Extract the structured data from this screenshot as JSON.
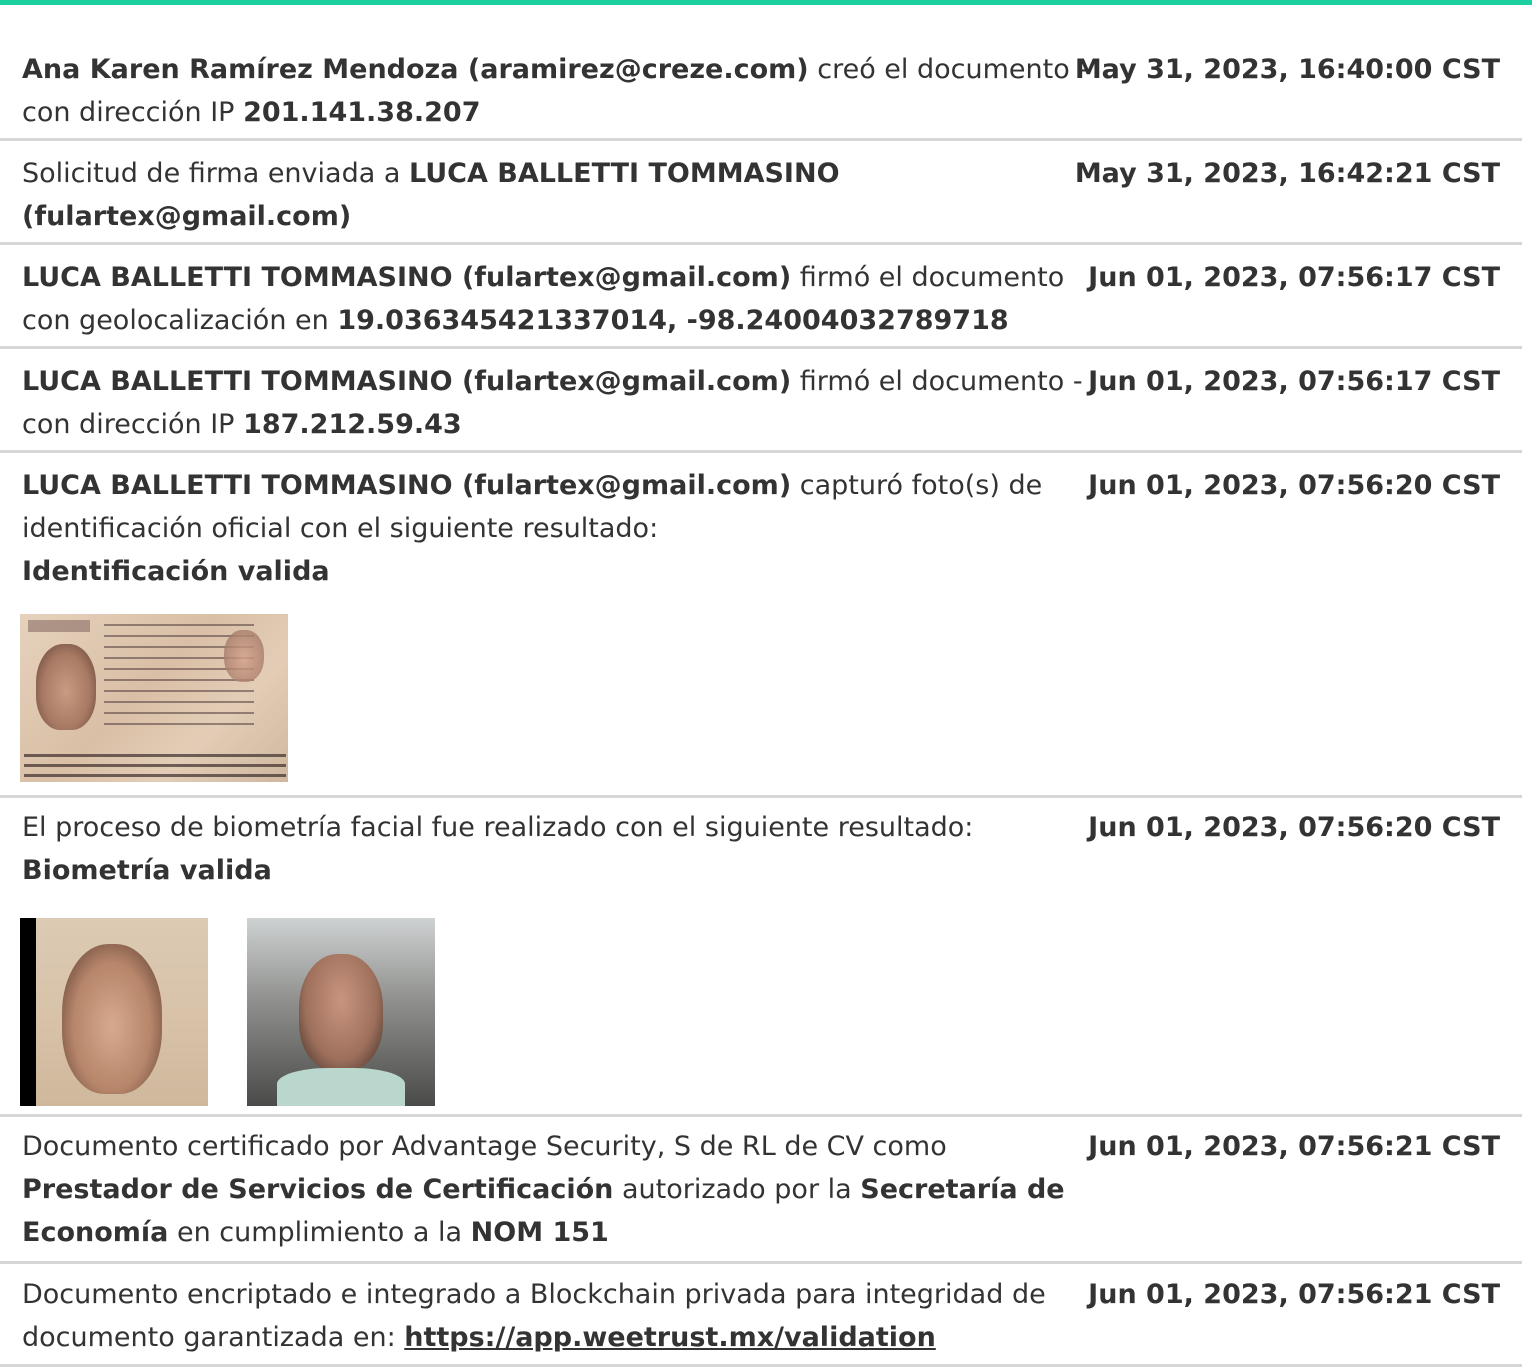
{
  "entries": [
    {
      "actor": "Ana Karen Ramírez Mendoza (aramirez@creze.com)",
      "action": " creó el documento - con dirección IP ",
      "ip": "201.141.38.207",
      "timestamp": "May 31, 2023, 16:40:00 CST"
    },
    {
      "action": "Solicitud de firma enviada a ",
      "recipient": "LUCA BALLETTI TOMMASINO (fulartex@gmail.com)",
      "timestamp": "May 31, 2023, 16:42:21 CST"
    },
    {
      "actor": "LUCA BALLETTI TOMMASINO (fulartex@gmail.com)",
      "action": " firmó el documento con geolocalización en ",
      "coords": "19.036345421337014, -98.24004032789718",
      "timestamp": "Jun 01, 2023, 07:56:17 CST"
    },
    {
      "actor": "LUCA BALLETTI TOMMASINO (fulartex@gmail.com)",
      "action": " firmó el documento - con dirección IP ",
      "ip": "187.212.59.43",
      "timestamp": "Jun 01, 2023, 07:56:17 CST"
    },
    {
      "actor": "LUCA BALLETTI TOMMASINO (fulartex@gmail.com)",
      "action": " capturó foto(s) de identificación oficial con el siguiente resultado:",
      "result": "Identificación valida",
      "timestamp": "Jun 01, 2023, 07:56:20 CST"
    },
    {
      "action": "El proceso de biometría facial fue realizado con el siguiente resultado:",
      "result": "Biometría valida",
      "timestamp": "Jun 01, 2023, 07:56:20 CST"
    },
    {
      "text1": "Documento certificado por Advantage Security, S de RL de CV como ",
      "bold1": "Prestador de Servicios de Certificación",
      "text2": " autorizado por la ",
      "bold2": "Secretaría de Economía",
      "text3": " en cumplimiento a la ",
      "bold3": "NOM 151",
      "timestamp": "Jun 01, 2023, 07:56:21 CST"
    },
    {
      "text1": "Documento encriptado e integrado a Blockchain privada para integridad de documento garantizada en: ",
      "link": "https://app.weetrust.mx/validation",
      "timestamp": "Jun 01, 2023, 07:56:21 CST"
    }
  ],
  "colors": {
    "accent_bar": "#1ccf9f",
    "divider": "#d6d6d6",
    "text": "#333333"
  }
}
